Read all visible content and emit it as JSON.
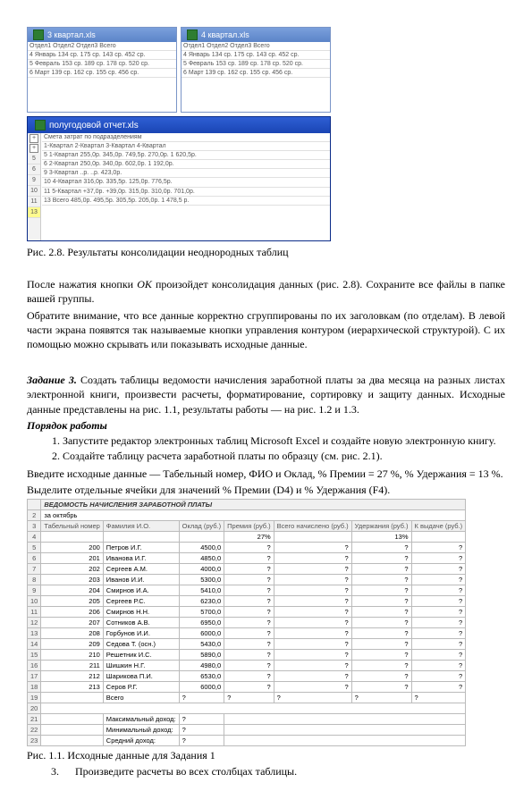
{
  "shot1": {
    "win_a_title": "3 квартал.xls",
    "win_b_title": "4 квартал.xls",
    "win_c_title": "полугодовой отчет.xls",
    "dummy_rows": [
      "Отдел1   Отдел2   Отдел3   Всего",
      "4 Январь  134 ср.  175 ср.  143 ср.  452 ср.",
      "5 Февраль 153 ср.  189 ср.  178 ср.  520 ср.",
      "6 Март   139 ср.  162 ср.  155 ср.  456 ср."
    ],
    "big_rows": [
      "Смета затрат по подразделениям",
      "  1-Квартал   2-Квартал   3-Квартал   4-Квартал",
      "5  1-Квартал   255,0р.   345,0р.   749,5р.   270,0р.   1 620,5р.",
      "6  2-Квартал   250,0р.   340,0р.   602,0р.             1 192,0р.",
      "9  3-Квартал   ..р.      ..р.                           423,0р.",
      "10 4-Квартал              316,0р.   335,5р.   125,0р.   776,5р.",
      "11 5-Квартал   +37,0р.   +39,0р.   315,0р.   310,0р.   701,0р.",
      "13   Всего   485,0р.   495,5р.   305,5р.   205,0р.   1 478,5 р."
    ]
  },
  "caption1": "Рис. 2.8. Результаты консолидации неоднородных таблиц",
  "para1a": "После нажатия кнопки ",
  "para1b": " произойдет консолидация данных (рис. 2.8). Сохраните все файлы в папке вашей группы.",
  "ok": "ОК",
  "para2": "Обратите внимание, что все данные корректно сгруппированы по их заголовкам (по отделам). В левой части экрана появятся так называемые кнопки управления контуром (иерархической структурой). С их помощью можно скрывать или показывать исходные данные.",
  "task3_label": "Задание 3.",
  "task3_text": " Создать таблицы ведомости начисления заработной платы за два месяца на разных листах электронной книги, произвести расчеты, форматирование, сортировку и защиту данных. Исходные данные представлены на рис. 1.1, результаты работы — на рис. 1.2 и 1.3.",
  "order_label": "Порядок работы",
  "li1": "Запустите редактор электронных таблиц Microsoft Excel и создайте новую электронную книгу.",
  "li2": "Создайте таблицу расчета заработной платы по образцу (см. рис. 2.1).",
  "para3": "Введите исходные данные — Табельный номер, ФИО и Оклад, % Премии = 27 %, % Удержания = 13 %.",
  "para4": "Выделите отдельные ячейки для значений % Премии (D4) и % Удержания (F4).",
  "ss2": {
    "title": "ВЕДОМОСТЬ НАЧИСЛЕНИЯ ЗАРАБОТНОЙ ПЛАТЫ",
    "subtitle": "за октябрь",
    "headers": [
      "Табельный номер",
      "Фамилия И.О.",
      "Оклад (руб.)",
      "Премия (руб.)",
      "Всего начислено (руб.)",
      "Удержания (руб.)",
      "К выдаче (руб.)"
    ],
    "pct_row": [
      "",
      "",
      "",
      "27%",
      "",
      "13%",
      ""
    ],
    "rows": [
      [
        "200",
        "Петров И.Г.",
        "4500,0",
        "?",
        "?",
        "?",
        "?"
      ],
      [
        "201",
        "Иванова И.Г.",
        "4850,0",
        "?",
        "?",
        "?",
        "?"
      ],
      [
        "202",
        "Сергеев А.М.",
        "4000,0",
        "?",
        "?",
        "?",
        "?"
      ],
      [
        "203",
        "Иванов И.И.",
        "5300,0",
        "?",
        "?",
        "?",
        "?"
      ],
      [
        "204",
        "Смирнов И.А.",
        "5410,0",
        "?",
        "?",
        "?",
        "?"
      ],
      [
        "205",
        "Сергеев Р.С.",
        "6230,0",
        "?",
        "?",
        "?",
        "?"
      ],
      [
        "206",
        "Смирнов Н.Н.",
        "5700,0",
        "?",
        "?",
        "?",
        "?"
      ],
      [
        "207",
        "Сотников А.В.",
        "6950,0",
        "?",
        "?",
        "?",
        "?"
      ],
      [
        "208",
        "Горбунов И.И.",
        "6000,0",
        "?",
        "?",
        "?",
        "?"
      ],
      [
        "209",
        "Седова Т. (осн.)",
        "5430,0",
        "?",
        "?",
        "?",
        "?"
      ],
      [
        "210",
        "Решетник И.С.",
        "5890,0",
        "?",
        "?",
        "?",
        "?"
      ],
      [
        "211",
        "Шишкин Н.Г.",
        "4980,0",
        "?",
        "?",
        "?",
        "?"
      ],
      [
        "212",
        "Шарикова П.И.",
        "6530,0",
        "?",
        "?",
        "?",
        "?"
      ],
      [
        "213",
        "Серов Р.Г.",
        "6000,0",
        "?",
        "?",
        "?",
        "?"
      ]
    ],
    "total_label": "Всего",
    "maxrow": "Максимальный доход:",
    "minrow": "Минимальный доход:",
    "avgrow": "Средний доход:"
  },
  "caption2": "Рис. 1.1. Исходные данные для Задания 1",
  "li3_num": "3.",
  "li3_text": "Произведите расчеты во всех столбцах таблицы."
}
